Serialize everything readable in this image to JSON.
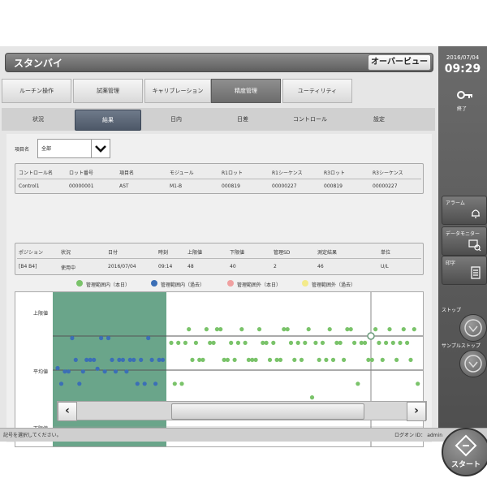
{
  "header": {
    "title": "スタンバイ",
    "overview_label": "オーバービュー"
  },
  "clock": {
    "date": "2016/07/04",
    "time": "09:29"
  },
  "side": {
    "key_label": "終了",
    "alarm": "アラーム",
    "data_monitor": "データモニター",
    "print": "印字",
    "stop": "ストップ",
    "sample_stop": "サンプルストップ",
    "start": "スタート"
  },
  "main_tabs": [
    {
      "label": "ルーチン操作"
    },
    {
      "label": "試薬管理"
    },
    {
      "label": "キャリブレーション"
    },
    {
      "label": "精度管理"
    },
    {
      "label": "ユーティリティ"
    }
  ],
  "sub_tabs": [
    {
      "label": "状況"
    },
    {
      "label": "結果"
    },
    {
      "label": "日内"
    },
    {
      "label": "日差"
    },
    {
      "label": "コントロール"
    },
    {
      "label": "設定"
    }
  ],
  "filter": {
    "label": "項目名",
    "value": "全部"
  },
  "table1": {
    "headers": [
      "コントロール名",
      "ロット番号",
      "項目名",
      "モジュール",
      "R1ロット",
      "R1シーケンス",
      "R3ロット",
      "R3シーケンス"
    ],
    "row": [
      "Control1",
      "00000001",
      "AST",
      "M1-B",
      "000819",
      "00000227",
      "000819",
      "00000227"
    ]
  },
  "table2": {
    "headers": [
      "ポジション",
      "状況",
      "日付",
      "時刻",
      "上限値",
      "下限値",
      "管理SD",
      "測定結果",
      "単位"
    ],
    "row": [
      "[B4 B4]",
      "使用中",
      "2016/07/04",
      "09:14",
      "48",
      "40",
      "2",
      "46",
      "U/L"
    ]
  },
  "legend": [
    {
      "label": "管理範囲内（本日）",
      "color": "#7ac36a"
    },
    {
      "label": "管理範囲内（過去）",
      "color": "#3b6fb6"
    },
    {
      "label": "管理範囲外（本日）",
      "color": "#f0a0a0"
    },
    {
      "label": "管理範囲外（過去）",
      "color": "#f3ea8a"
    }
  ],
  "chart_data": {
    "type": "scatter",
    "ylabels": [
      "上限値",
      "平均値",
      "下限値"
    ],
    "series": [
      {
        "values": [
          0.03,
          -0.2,
          -0.02,
          -0.02,
          0.47,
          0.15,
          -0.2,
          -0.02,
          0.15,
          0.15,
          0.15,
          0.02,
          0.47,
          -0.02,
          0.47,
          0.15,
          -0.02,
          0.15,
          0.15,
          -0.02,
          0.15,
          0.15,
          -0.2,
          0.15,
          -0.2,
          0.47,
          0.15,
          -0.2,
          0.15,
          0.15
        ]
      },
      {
        "values": [
          0.4,
          -0.2,
          0.4,
          -0.2,
          0.4,
          0.6,
          0.15,
          0.4,
          0.15,
          0.15,
          0.6,
          0.4,
          0.4,
          0.6,
          0.6,
          0.15,
          0.15,
          0.4,
          0.15,
          0.4,
          0.6,
          0.4,
          0.15,
          0.15,
          0.15,
          0.6,
          0.4,
          0.4,
          0.15,
          0.4,
          0.15,
          0.15,
          0.6,
          0.6,
          0.4,
          0.15,
          0.4,
          0.15,
          0.4,
          0.6,
          -0.4,
          0.4,
          0.15,
          0.4,
          0.15,
          0.6,
          0.15,
          0.4,
          0.4,
          0.15,
          0.6,
          0.6,
          0.4,
          -0.2,
          0.4,
          0.4,
          0.15,
          0.15,
          0.6,
          0.4,
          0.15,
          0.4,
          0.6,
          0.4,
          0.15,
          0.4,
          0.6,
          0.4,
          0.15,
          0.6,
          -0.2
        ]
      }
    ]
  },
  "status": {
    "message": "記号を選択してください。",
    "login": "ログオン ID： admin"
  }
}
